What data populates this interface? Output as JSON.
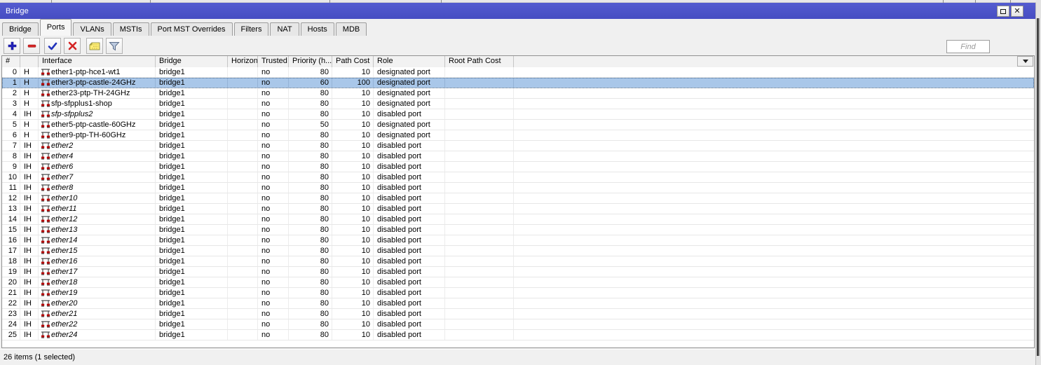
{
  "window": {
    "title": "Bridge",
    "controls": {
      "maximize": "",
      "close": "x"
    },
    "tabs": [
      {
        "label": "Bridge",
        "active": false
      },
      {
        "label": "Ports",
        "active": true
      },
      {
        "label": "VLANs",
        "active": false
      },
      {
        "label": "MSTIs",
        "active": false
      },
      {
        "label": "Port MST Overrides",
        "active": false
      },
      {
        "label": "Filters",
        "active": false
      },
      {
        "label": "NAT",
        "active": false
      },
      {
        "label": "Hosts",
        "active": false
      },
      {
        "label": "MDB",
        "active": false
      }
    ],
    "toolbar": {
      "buttons": [
        "add-button",
        "remove-button",
        "enable-button",
        "disable-button",
        "comment-button",
        "filter-button"
      ],
      "find_placeholder": "Find"
    },
    "table": {
      "columns": [
        {
          "label": "#"
        },
        {
          "label": ""
        },
        {
          "label": "Interface"
        },
        {
          "label": "Bridge"
        },
        {
          "label": "Horizon"
        },
        {
          "label": "Trusted"
        },
        {
          "label": "Priority (h..."
        },
        {
          "label": "Path Cost"
        },
        {
          "label": "Role"
        },
        {
          "label": "Root Path Cost"
        }
      ],
      "rows": [
        {
          "num": "0",
          "flags": "H",
          "interface": "ether1-ptp-hce1-wt1",
          "bridge": "bridge1",
          "horizon": "",
          "trusted": "no",
          "priority": "80",
          "path_cost": "10",
          "role": "designated port",
          "root_path_cost": "",
          "inactive": false,
          "selected": false
        },
        {
          "num": "1",
          "flags": "H",
          "interface": "ether3-ptp-castle-24GHz",
          "bridge": "bridge1",
          "horizon": "",
          "trusted": "no",
          "priority": "60",
          "path_cost": "100",
          "role": "designated port",
          "root_path_cost": "",
          "inactive": false,
          "selected": true
        },
        {
          "num": "2",
          "flags": "H",
          "interface": "ether23-ptp-TH-24GHz",
          "bridge": "bridge1",
          "horizon": "",
          "trusted": "no",
          "priority": "80",
          "path_cost": "10",
          "role": "designated port",
          "root_path_cost": "",
          "inactive": false,
          "selected": false
        },
        {
          "num": "3",
          "flags": "H",
          "interface": "sfp-sfpplus1-shop",
          "bridge": "bridge1",
          "horizon": "",
          "trusted": "no",
          "priority": "80",
          "path_cost": "10",
          "role": "designated port",
          "root_path_cost": "",
          "inactive": false,
          "selected": false
        },
        {
          "num": "4",
          "flags": "IH",
          "interface": "sfp-sfpplus2",
          "bridge": "bridge1",
          "horizon": "",
          "trusted": "no",
          "priority": "80",
          "path_cost": "10",
          "role": "disabled port",
          "root_path_cost": "",
          "inactive": true,
          "selected": false
        },
        {
          "num": "5",
          "flags": "H",
          "interface": "ether5-ptp-castle-60GHz",
          "bridge": "bridge1",
          "horizon": "",
          "trusted": "no",
          "priority": "50",
          "path_cost": "10",
          "role": "designated port",
          "root_path_cost": "",
          "inactive": false,
          "selected": false
        },
        {
          "num": "6",
          "flags": "H",
          "interface": "ether9-ptp-TH-60GHz",
          "bridge": "bridge1",
          "horizon": "",
          "trusted": "no",
          "priority": "80",
          "path_cost": "10",
          "role": "designated port",
          "root_path_cost": "",
          "inactive": false,
          "selected": false
        },
        {
          "num": "7",
          "flags": "IH",
          "interface": "ether2",
          "bridge": "bridge1",
          "horizon": "",
          "trusted": "no",
          "priority": "80",
          "path_cost": "10",
          "role": "disabled port",
          "root_path_cost": "",
          "inactive": true,
          "selected": false
        },
        {
          "num": "8",
          "flags": "IH",
          "interface": "ether4",
          "bridge": "bridge1",
          "horizon": "",
          "trusted": "no",
          "priority": "80",
          "path_cost": "10",
          "role": "disabled port",
          "root_path_cost": "",
          "inactive": true,
          "selected": false
        },
        {
          "num": "9",
          "flags": "IH",
          "interface": "ether6",
          "bridge": "bridge1",
          "horizon": "",
          "trusted": "no",
          "priority": "80",
          "path_cost": "10",
          "role": "disabled port",
          "root_path_cost": "",
          "inactive": true,
          "selected": false
        },
        {
          "num": "10",
          "flags": "IH",
          "interface": "ether7",
          "bridge": "bridge1",
          "horizon": "",
          "trusted": "no",
          "priority": "80",
          "path_cost": "10",
          "role": "disabled port",
          "root_path_cost": "",
          "inactive": true,
          "selected": false
        },
        {
          "num": "11",
          "flags": "IH",
          "interface": "ether8",
          "bridge": "bridge1",
          "horizon": "",
          "trusted": "no",
          "priority": "80",
          "path_cost": "10",
          "role": "disabled port",
          "root_path_cost": "",
          "inactive": true,
          "selected": false
        },
        {
          "num": "12",
          "flags": "IH",
          "interface": "ether10",
          "bridge": "bridge1",
          "horizon": "",
          "trusted": "no",
          "priority": "80",
          "path_cost": "10",
          "role": "disabled port",
          "root_path_cost": "",
          "inactive": true,
          "selected": false
        },
        {
          "num": "13",
          "flags": "IH",
          "interface": "ether11",
          "bridge": "bridge1",
          "horizon": "",
          "trusted": "no",
          "priority": "80",
          "path_cost": "10",
          "role": "disabled port",
          "root_path_cost": "",
          "inactive": true,
          "selected": false
        },
        {
          "num": "14",
          "flags": "IH",
          "interface": "ether12",
          "bridge": "bridge1",
          "horizon": "",
          "trusted": "no",
          "priority": "80",
          "path_cost": "10",
          "role": "disabled port",
          "root_path_cost": "",
          "inactive": true,
          "selected": false
        },
        {
          "num": "15",
          "flags": "IH",
          "interface": "ether13",
          "bridge": "bridge1",
          "horizon": "",
          "trusted": "no",
          "priority": "80",
          "path_cost": "10",
          "role": "disabled port",
          "root_path_cost": "",
          "inactive": true,
          "selected": false
        },
        {
          "num": "16",
          "flags": "IH",
          "interface": "ether14",
          "bridge": "bridge1",
          "horizon": "",
          "trusted": "no",
          "priority": "80",
          "path_cost": "10",
          "role": "disabled port",
          "root_path_cost": "",
          "inactive": true,
          "selected": false
        },
        {
          "num": "17",
          "flags": "IH",
          "interface": "ether15",
          "bridge": "bridge1",
          "horizon": "",
          "trusted": "no",
          "priority": "80",
          "path_cost": "10",
          "role": "disabled port",
          "root_path_cost": "",
          "inactive": true,
          "selected": false
        },
        {
          "num": "18",
          "flags": "IH",
          "interface": "ether16",
          "bridge": "bridge1",
          "horizon": "",
          "trusted": "no",
          "priority": "80",
          "path_cost": "10",
          "role": "disabled port",
          "root_path_cost": "",
          "inactive": true,
          "selected": false
        },
        {
          "num": "19",
          "flags": "IH",
          "interface": "ether17",
          "bridge": "bridge1",
          "horizon": "",
          "trusted": "no",
          "priority": "80",
          "path_cost": "10",
          "role": "disabled port",
          "root_path_cost": "",
          "inactive": true,
          "selected": false
        },
        {
          "num": "20",
          "flags": "IH",
          "interface": "ether18",
          "bridge": "bridge1",
          "horizon": "",
          "trusted": "no",
          "priority": "80",
          "path_cost": "10",
          "role": "disabled port",
          "root_path_cost": "",
          "inactive": true,
          "selected": false
        },
        {
          "num": "21",
          "flags": "IH",
          "interface": "ether19",
          "bridge": "bridge1",
          "horizon": "",
          "trusted": "no",
          "priority": "80",
          "path_cost": "10",
          "role": "disabled port",
          "root_path_cost": "",
          "inactive": true,
          "selected": false
        },
        {
          "num": "22",
          "flags": "IH",
          "interface": "ether20",
          "bridge": "bridge1",
          "horizon": "",
          "trusted": "no",
          "priority": "80",
          "path_cost": "10",
          "role": "disabled port",
          "root_path_cost": "",
          "inactive": true,
          "selected": false
        },
        {
          "num": "23",
          "flags": "IH",
          "interface": "ether21",
          "bridge": "bridge1",
          "horizon": "",
          "trusted": "no",
          "priority": "80",
          "path_cost": "10",
          "role": "disabled port",
          "root_path_cost": "",
          "inactive": true,
          "selected": false
        },
        {
          "num": "24",
          "flags": "IH",
          "interface": "ether22",
          "bridge": "bridge1",
          "horizon": "",
          "trusted": "no",
          "priority": "80",
          "path_cost": "10",
          "role": "disabled port",
          "root_path_cost": "",
          "inactive": true,
          "selected": false
        },
        {
          "num": "25",
          "flags": "IH",
          "interface": "ether24",
          "bridge": "bridge1",
          "horizon": "",
          "trusted": "no",
          "priority": "80",
          "path_cost": "10",
          "role": "disabled port",
          "root_path_cost": "",
          "inactive": true,
          "selected": false
        }
      ]
    },
    "status_bar": {
      "text": "26 items (1 selected)"
    }
  },
  "colors": {
    "titlebar_blue": "#4a51c6",
    "selection_blue": "#a9c7e9",
    "icon_red": "#b40000",
    "note_yellow": "#ffee77",
    "accent_blue_icon": "#2222bb",
    "accent_red_icon": "#d42424"
  }
}
